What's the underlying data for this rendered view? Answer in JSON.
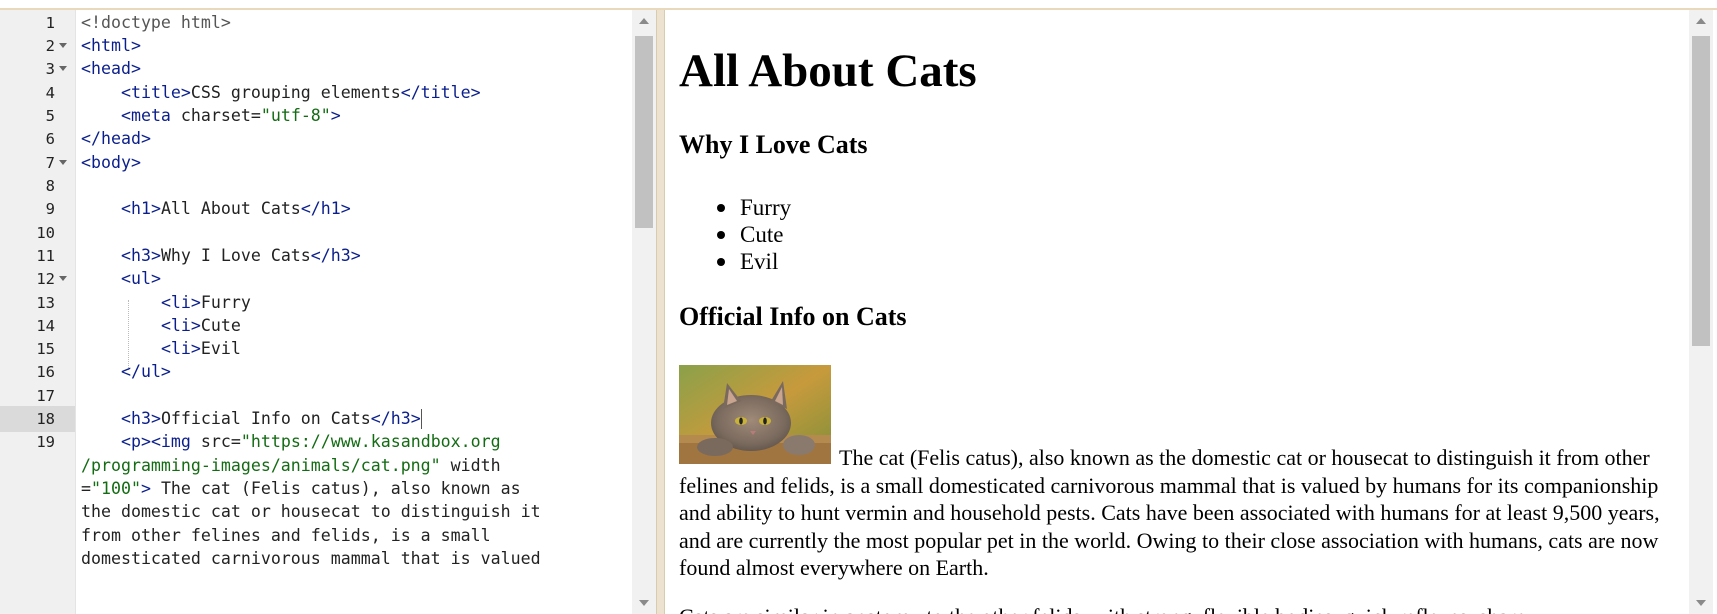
{
  "editor": {
    "line_numbers": [
      "1",
      "2",
      "3",
      "4",
      "5",
      "6",
      "7",
      "8",
      "9",
      "10",
      "11",
      "12",
      "13",
      "14",
      "15",
      "16",
      "17",
      "18",
      "19"
    ],
    "lines": {
      "l1": {
        "doc": "<!doctype html>"
      },
      "l2": {
        "tag": "<html>"
      },
      "l3": {
        "tag": "<head>"
      },
      "l4": {
        "open": "<title>",
        "text": "CSS grouping elements",
        "close": "</title>"
      },
      "l5": {
        "open": "<meta ",
        "attr": "charset=",
        "str": "\"utf-8\"",
        "close": ">"
      },
      "l6": {
        "tag": "</head>"
      },
      "l7": {
        "tag": "<body>"
      },
      "l9": {
        "open": "<h1>",
        "text": "All About Cats",
        "close": "</h1>"
      },
      "l11": {
        "open": "<h3>",
        "text": "Why I Love Cats",
        "close": "</h3>"
      },
      "l12": {
        "tag": "<ul>"
      },
      "l13": {
        "open": "<li>",
        "text": "Furry"
      },
      "l14": {
        "open": "<li>",
        "text": "Cute"
      },
      "l15": {
        "open": "<li>",
        "text": "Evil"
      },
      "l16": {
        "tag": "</ul>"
      },
      "l18": {
        "open": "<h3>",
        "text": "Official Info on Cats",
        "close": "</h3>"
      },
      "l19": {
        "open": "<p><img ",
        "attr": "src=",
        "str": "\"https://www.kasandbox.org"
      },
      "w1": {
        "str": "/programming-images/animals/cat.png\"",
        "attr": " width"
      },
      "w2": {
        "attr": "=",
        "str": "\"100\"",
        "close": ">",
        "text": " The cat (Felis catus), also known as"
      },
      "w3": {
        "text": "the domestic cat or housecat to distinguish it"
      },
      "w4": {
        "text": "from other felines and felids, is a small"
      },
      "w5": {
        "text": "domesticated carnivorous mammal that is valued"
      }
    }
  },
  "preview": {
    "h1": "All About Cats",
    "h3_love": "Why I Love Cats",
    "list": [
      "Furry",
      "Cute",
      "Evil"
    ],
    "h3_official": "Official Info on Cats",
    "paragraph": "The cat (Felis catus), also known as the domestic cat or housecat to distinguish it from other felines and felids, is a small domesticated carnivorous mammal that is valued by humans for its companionship and ability to hunt vermin and household pests. Cats have been associated with humans for at least 9,500 years, and are currently the most popular pet in the world. Owing to their close association with humans, cats are now found almost everywhere on Earth.",
    "paragraph2_partial": "Cats are similar in anatomy to the other felids, with strong, flexible bodies, quick reflexes, sharp"
  },
  "colors": {
    "tag": "#0b1f8c",
    "string": "#136b13",
    "doctype": "#555555",
    "gutter_bg": "#f0f0f0",
    "divider": "#ece2cf"
  },
  "icons": [
    "scroll-up-arrow-icon",
    "scroll-down-arrow-icon",
    "fold-arrow-icon",
    "cat-photo"
  ]
}
